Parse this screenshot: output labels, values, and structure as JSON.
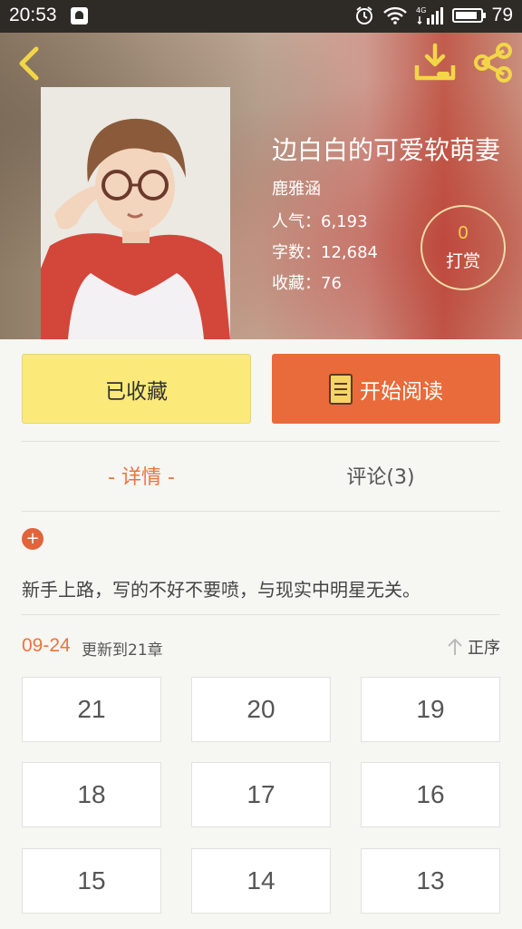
{
  "status_bar": {
    "time": "20:53",
    "battery": "79"
  },
  "book": {
    "title": "边白白的可爱软萌妻",
    "author": "鹿雅涵",
    "popularity": "人气：6,193",
    "word_count": "字数：12,684",
    "favorites": "收藏：76"
  },
  "reward": {
    "count": "0",
    "label": "打赏"
  },
  "actions": {
    "favorite_label": "已收藏",
    "read_label": "开始阅读"
  },
  "tabs": {
    "detail": "- 详情 -",
    "comments": "评论(3)"
  },
  "expand_icon": "+",
  "description": "新手上路，写的不好不要喷，与现实中明星无关。",
  "updates": {
    "date": "09-24",
    "text": "更新到21章",
    "sort_label": "正序"
  },
  "chapters": [
    "21",
    "20",
    "19",
    "18",
    "17",
    "16",
    "15",
    "14",
    "13"
  ],
  "colors": {
    "accent": "#e9743f",
    "favorite_bg": "#fbea7a",
    "read_bg": "#e96a3a"
  }
}
